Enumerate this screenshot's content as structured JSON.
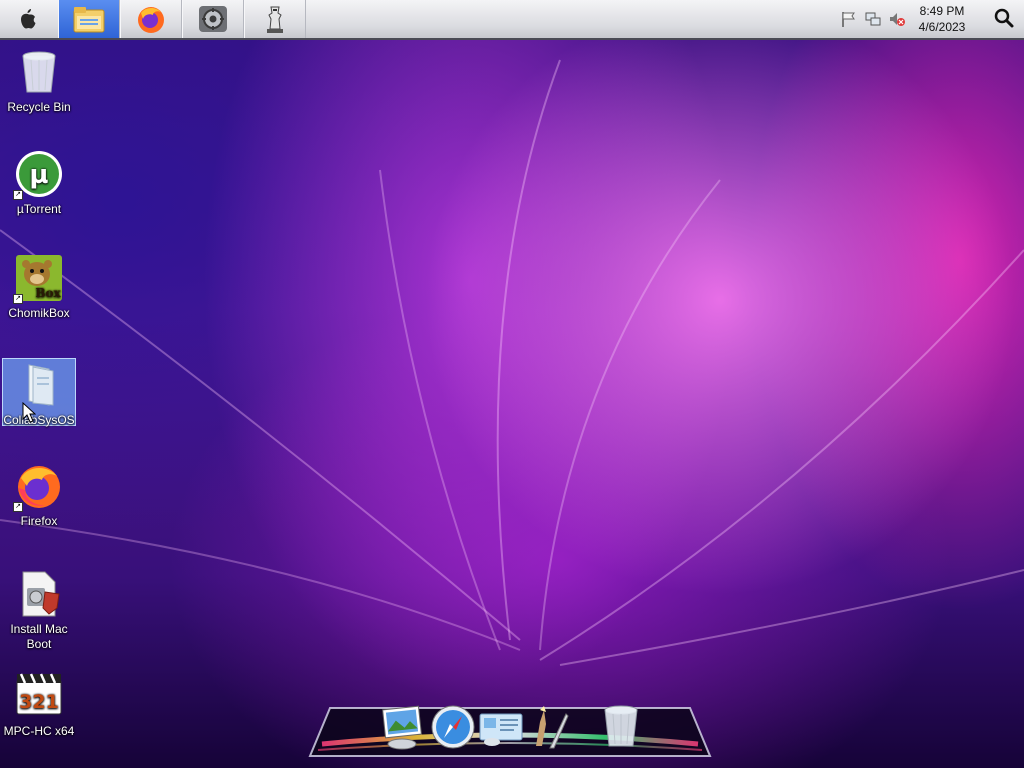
{
  "taskbar": {
    "apple_glyph": "",
    "pinned": [
      {
        "name": "File Explorer",
        "icon": "folder-icon",
        "active": true
      },
      {
        "name": "Firefox",
        "icon": "firefox-icon",
        "active": false
      },
      {
        "name": "System Preferences",
        "icon": "settings-icon",
        "active": false
      },
      {
        "name": "Chess",
        "icon": "chess-icon",
        "active": false
      }
    ],
    "tray": {
      "icons": [
        "flag-icon",
        "network-icon",
        "volume-muted-icon"
      ]
    },
    "clock": {
      "time": "8:49 PM",
      "date": "4/6/2023"
    }
  },
  "desktop": {
    "icons": [
      {
        "label": "Recycle Bin",
        "icon": "recycle-bin-icon",
        "selected": false
      },
      {
        "label": "µTorrent",
        "icon": "utorrent-icon",
        "selected": false
      },
      {
        "label": "ChomikBox",
        "icon": "chomikbox-icon",
        "selected": false
      },
      {
        "label": "CollabSysOS",
        "icon": "folder-icon",
        "selected": true
      },
      {
        "label": "Firefox",
        "icon": "firefox-icon",
        "selected": false
      },
      {
        "label": "Install Mac Boot",
        "icon": "installer-icon",
        "selected": false
      },
      {
        "label": "MPC-HC x64",
        "icon": "mpc-hc-icon",
        "selected": false
      }
    ],
    "chomikbox_badge": "Box",
    "mpc_digits": "321"
  },
  "dock": {
    "items": [
      "preview-icon",
      "safari-icon",
      "mail-icon",
      "quill-icon",
      "trash-icon"
    ]
  },
  "colors": {
    "menubar_active": "#2f64d6",
    "wallpaper_primary": "#4b1692",
    "wallpaper_accent": "#f078e8"
  }
}
